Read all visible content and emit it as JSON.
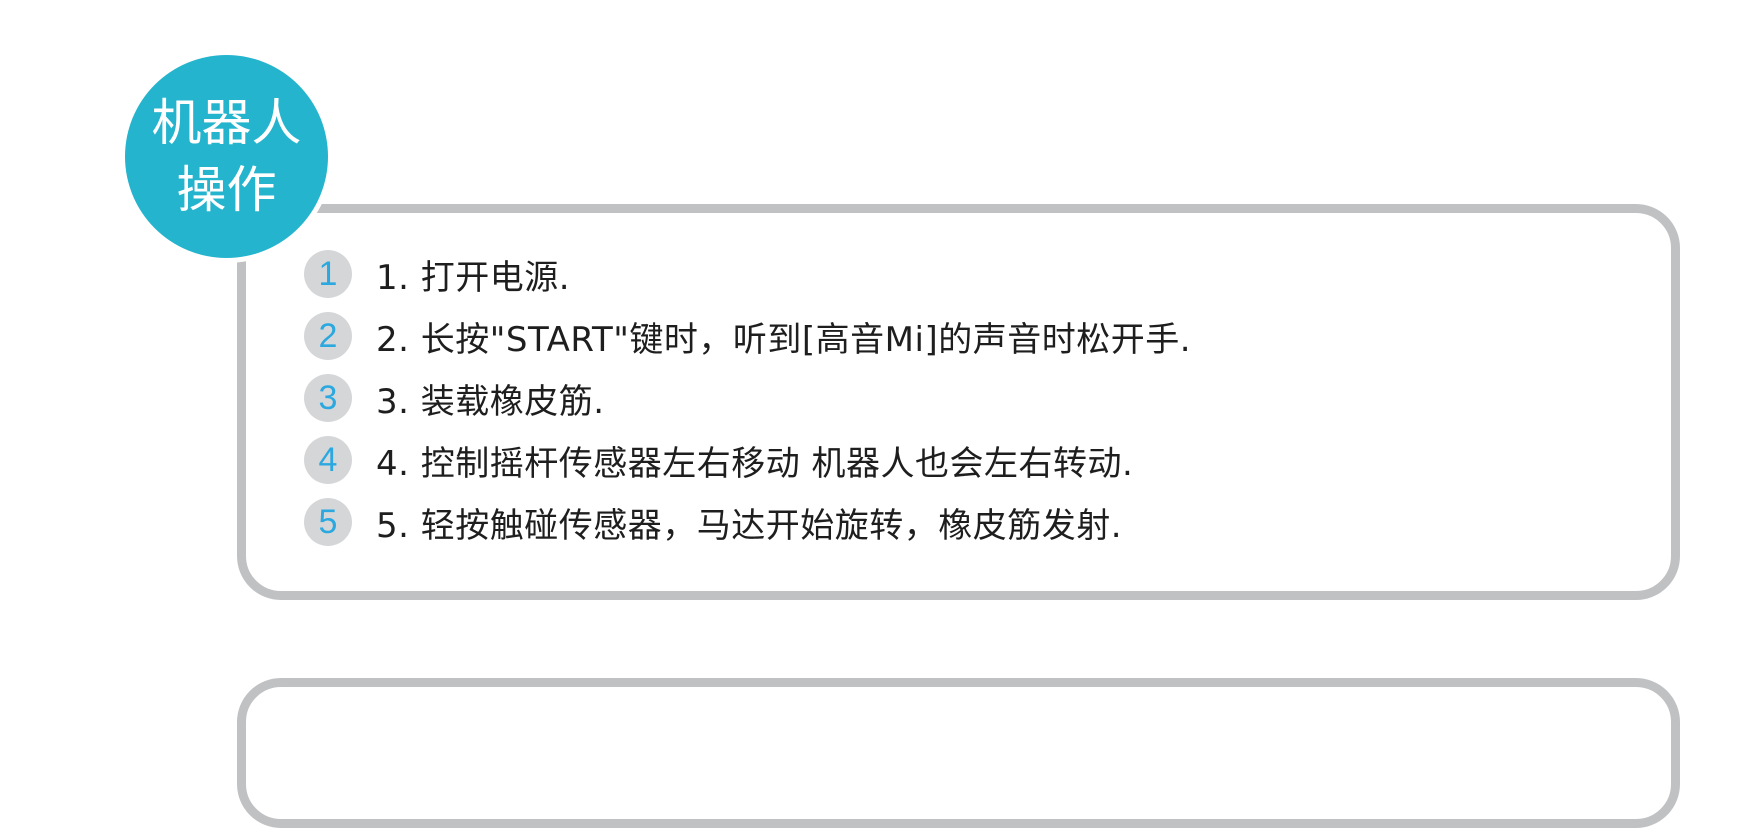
{
  "badge": {
    "line1": "机器人",
    "line2": "操作"
  },
  "colors": {
    "badge": "#25b4cd",
    "panel_border": "#c0c1c3",
    "step_circle": "#d5d6d8",
    "step_number": "#2aa8df",
    "text": "#1e1e1e"
  },
  "steps": [
    {
      "num": "1",
      "text": "1. 打开电源."
    },
    {
      "num": "2",
      "text": "2. 长按\"START\"键时，听到[高音Mi]的声音时松开手."
    },
    {
      "num": "3",
      "text": "3. 装载橡皮筋."
    },
    {
      "num": "4",
      "text": "4. 控制摇杆传感器左右移动 机器人也会左右转动."
    },
    {
      "num": "5",
      "text": "5. 轻按触碰传感器，马达开始旋转，橡皮筋发射."
    }
  ]
}
